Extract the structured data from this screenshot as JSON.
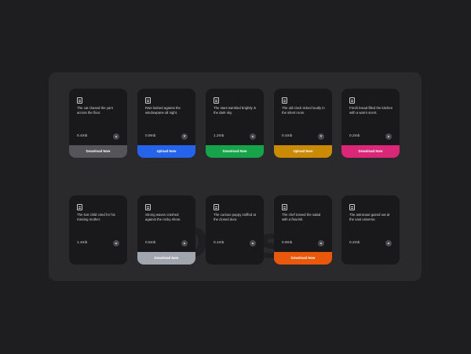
{
  "watermark": "Docs.",
  "cards": [
    {
      "desc": "The cat chased the yarn across the floor.",
      "size": "0.4mb",
      "icon": "upload-icon",
      "glyph": "▲",
      "button": "Download Now",
      "color": "#54545a"
    },
    {
      "desc": "Rain lashed against the windowpane all night.",
      "size": "0.9mb",
      "icon": "download-icon",
      "glyph": "▼",
      "button": "Upload Now",
      "color": "#2563eb"
    },
    {
      "desc": "The stars twinkled brightly in the dark sky.",
      "size": "1.2mb",
      "icon": "upload-icon",
      "glyph": "▲",
      "button": "Download Now",
      "color": "#16a34a"
    },
    {
      "desc": "The old clock ticked loudly in the silent room.",
      "size": "0.4mb",
      "icon": "download-icon",
      "glyph": "▼",
      "button": "Upload Now",
      "color": "#ca8a04"
    },
    {
      "desc": "Fresh bread filled the kitchen with a warm scent.",
      "size": "0.2mb",
      "icon": "upload-icon",
      "glyph": "▲",
      "button": "Download Now",
      "color": "#db2777"
    },
    {
      "desc": "The lost child cried for his missing mother.",
      "size": "1.4mb",
      "icon": "upload-icon",
      "glyph": "▲",
      "button": "",
      "color": ""
    },
    {
      "desc": "Strong waves crashed against the rocky shore.",
      "size": "0.5mb",
      "icon": "upload-icon",
      "glyph": "▲",
      "button": "Download Now",
      "color": "#a1a5ad"
    },
    {
      "desc": "The curious puppy sniffed at the closed door.",
      "size": "0.1mb",
      "icon": "upload-icon",
      "glyph": "▲",
      "button": "",
      "color": ""
    },
    {
      "desc": "The chef tossed the salad with a flourish.",
      "size": "0.9mb",
      "icon": "upload-icon",
      "glyph": "▲",
      "button": "Download Now",
      "color": "#ea580c"
    },
    {
      "desc": "The astronaut gazed out at the vast universe.",
      "size": "0.2mb",
      "icon": "upload-icon",
      "glyph": "▲",
      "button": "",
      "color": ""
    }
  ]
}
